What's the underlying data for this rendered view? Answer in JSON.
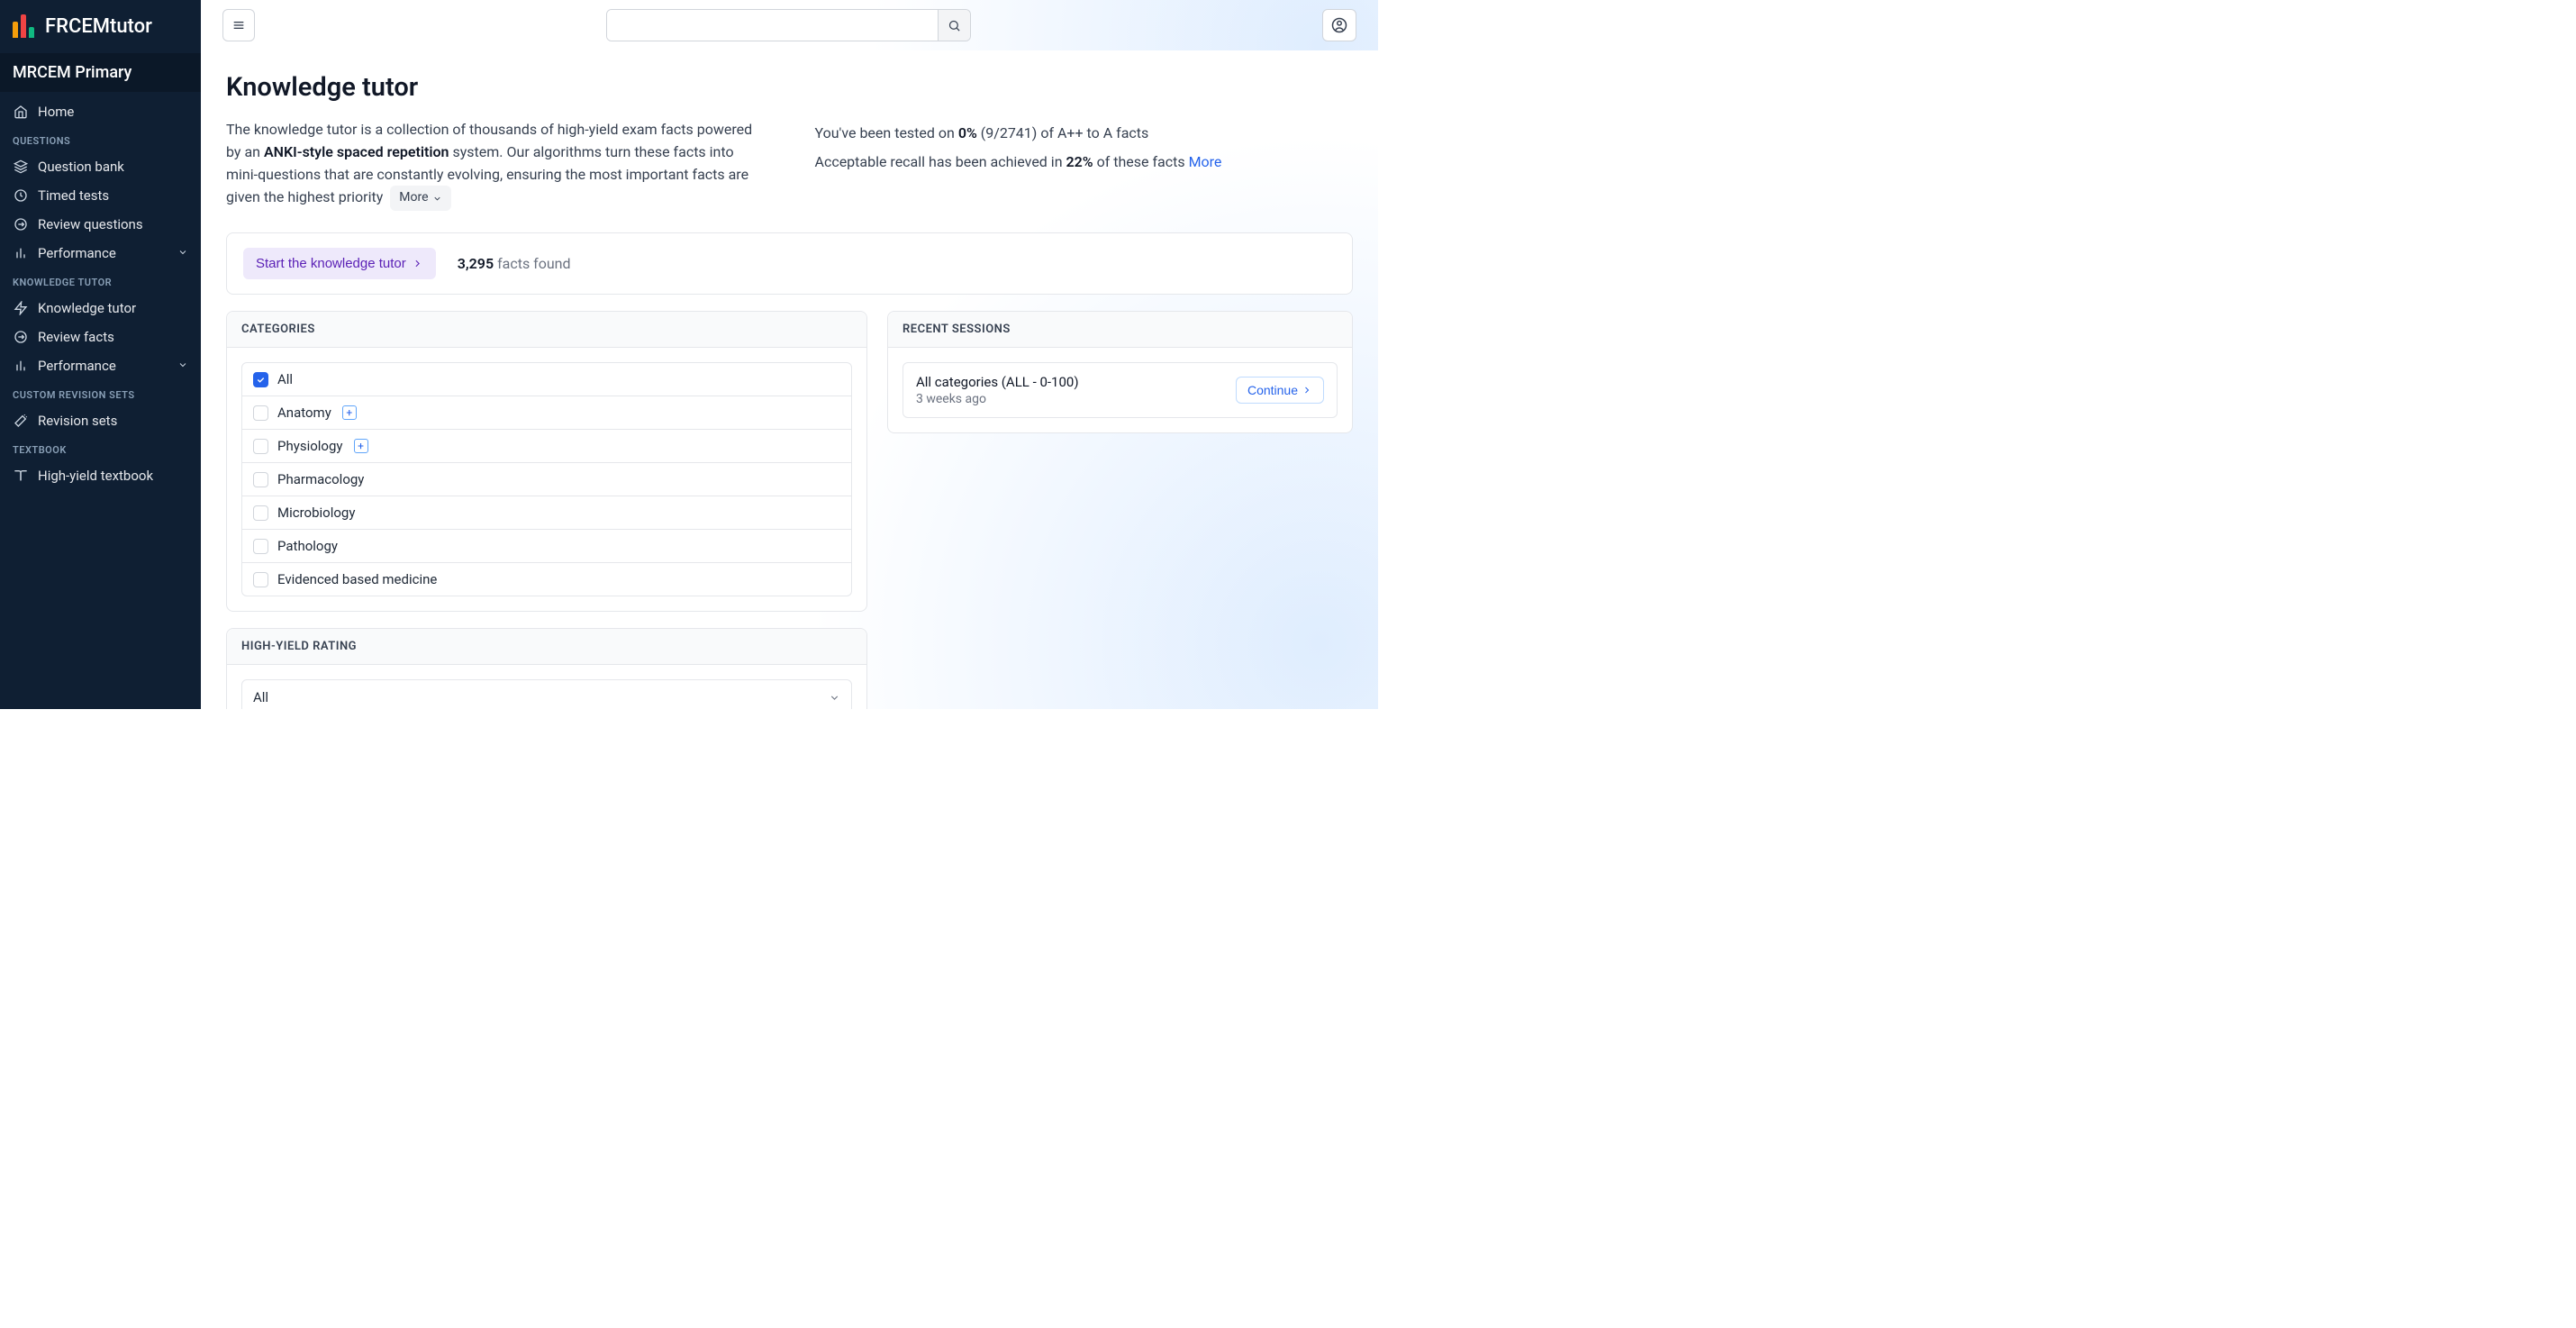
{
  "brand": "FRCEMtutor",
  "sidebar_title": "MRCEM Primary",
  "nav": {
    "home": "Home",
    "section_questions": "QUESTIONS",
    "question_bank": "Question bank",
    "timed_tests": "Timed tests",
    "review_questions": "Review questions",
    "performance1": "Performance",
    "section_knowledge": "KNOWLEDGE TUTOR",
    "knowledge_tutor": "Knowledge tutor",
    "review_facts": "Review facts",
    "performance2": "Performance",
    "section_custom": "CUSTOM REVISION SETS",
    "revision_sets": "Revision sets",
    "section_textbook": "TEXTBOOK",
    "textbook": "High-yield textbook"
  },
  "search_placeholder": "",
  "page_title": "Knowledge tutor",
  "intro": {
    "line1_a": "The knowledge tutor is a collection of thousands of high-yield exam facts powered by an ",
    "line1_bold": "ANKI-style spaced repetition",
    "line1_b": " system. Our algorithms turn these facts into mini-questions that are constantly evolving, ensuring the most important facts are given the highest priority",
    "more": "More"
  },
  "stats": {
    "s1_a": "You've been tested on ",
    "s1_bold": "0%",
    "s1_b": " (9/2741) of A++ to A facts",
    "s2_a": "Acceptable recall has been achieved in ",
    "s2_bold": "22%",
    "s2_b": " of these facts ",
    "more": "More"
  },
  "action": {
    "start": "Start the knowledge tutor",
    "count": "3,295",
    "found": " facts found"
  },
  "panels": {
    "categories": "CATEGORIES",
    "recent": "RECENT SESSIONS",
    "high_yield": "HIGH-YIELD RATING"
  },
  "categories": [
    {
      "label": "All",
      "checked": true,
      "expandable": false
    },
    {
      "label": "Anatomy",
      "checked": false,
      "expandable": true
    },
    {
      "label": "Physiology",
      "checked": false,
      "expandable": true
    },
    {
      "label": "Pharmacology",
      "checked": false,
      "expandable": false
    },
    {
      "label": "Microbiology",
      "checked": false,
      "expandable": false
    },
    {
      "label": "Pathology",
      "checked": false,
      "expandable": false
    },
    {
      "label": "Evidenced based medicine",
      "checked": false,
      "expandable": false
    }
  ],
  "high_yield_selected": "All",
  "session": {
    "title": "All categories (ALL - 0-100)",
    "sub": "3 weeks ago",
    "continue": "Continue"
  }
}
